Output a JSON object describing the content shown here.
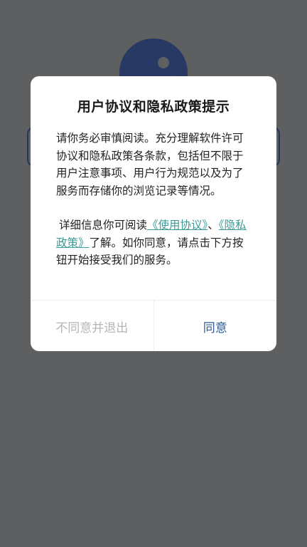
{
  "dialog": {
    "title": "用户协议和隐私政策提示",
    "paragraph1": "请你务必审慎阅读。充分理解软件许可协议和隐私政策各条款，包括但不限于用户注意事项、用户行为规范以及为了服务而存储你的浏览记录等情况。",
    "paragraph2_prefix": "详细信息你可阅读",
    "terms_link": "《使用协议》",
    "separator": "、",
    "privacy_link": "《隐私政策》",
    "paragraph2_suffix": "了解。如你同意，请点击下方按钮开始接受我们的服务。",
    "decline_label": "不同意并退出",
    "agree_label": "同意"
  },
  "colors": {
    "overlay": "#5d5f61",
    "link": "#3d9a97",
    "agree": "#2f5d96",
    "decline": "#b5b5b5"
  }
}
